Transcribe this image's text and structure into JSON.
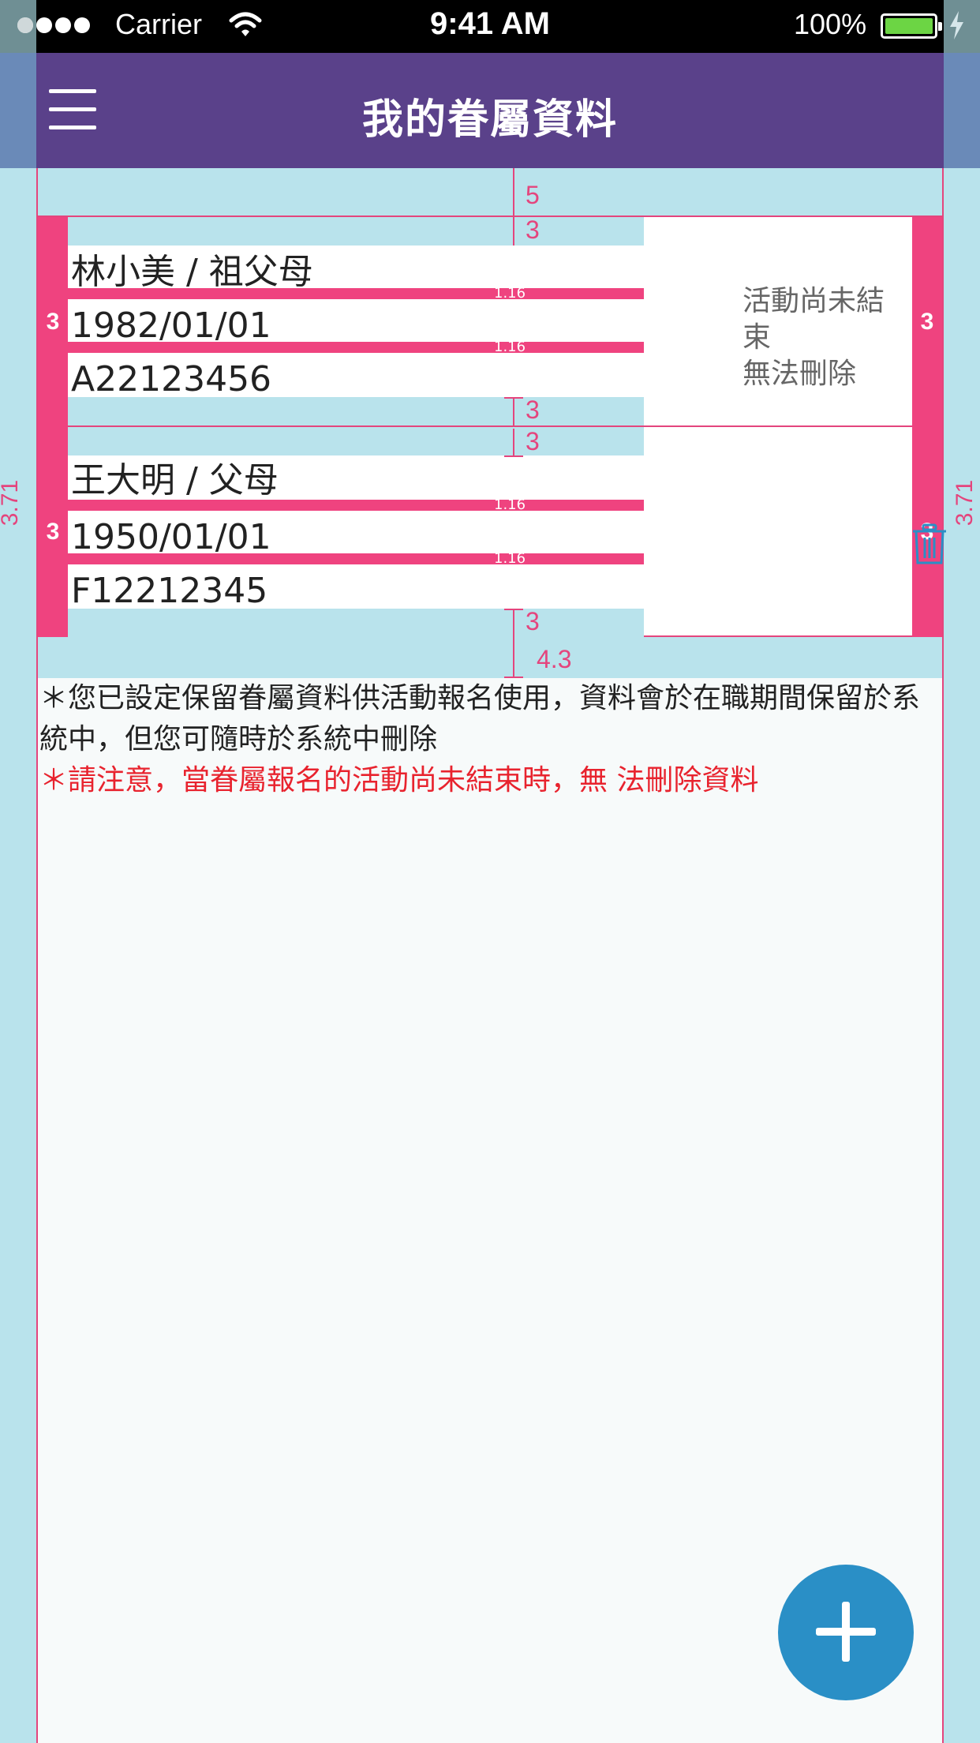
{
  "status_bar": {
    "carrier": "Carrier",
    "time": "9:41 AM",
    "battery_pct": "100%"
  },
  "nav": {
    "title": "我的眷屬資料",
    "menu_icon": "hamburger-icon"
  },
  "dependents": [
    {
      "name_relation": "林小美 / 祖父母",
      "birthdate": "1982/01/01",
      "id_number": "A22123456",
      "status_line1": "活動尚未結束",
      "status_line2": "無法刪除"
    },
    {
      "name_relation": "王大明 / 父母",
      "birthdate": "1950/01/01",
      "id_number": "F12212345",
      "action_icon": "trash-icon"
    }
  ],
  "annotations": {
    "top_gap": "5",
    "row_pad": "3",
    "line_gap": "1.16",
    "side_pad": "3",
    "bottom_gap": "4.3",
    "side_margin": "3.71"
  },
  "notes": {
    "info": "＊您已設定保留眷屬資料供活動報名使用，資料會於在職期間保留於系統中，但您可隨時於系統中刪除",
    "warning": "＊請注意，當眷屬報名的活動尚未結束時，無 法刪除資料"
  },
  "fab": {
    "icon": "plus-icon"
  },
  "colors": {
    "nav": "#5a418a",
    "accent": "#ef437f",
    "fab": "#2a8fc6",
    "warning": "#e8232e"
  }
}
